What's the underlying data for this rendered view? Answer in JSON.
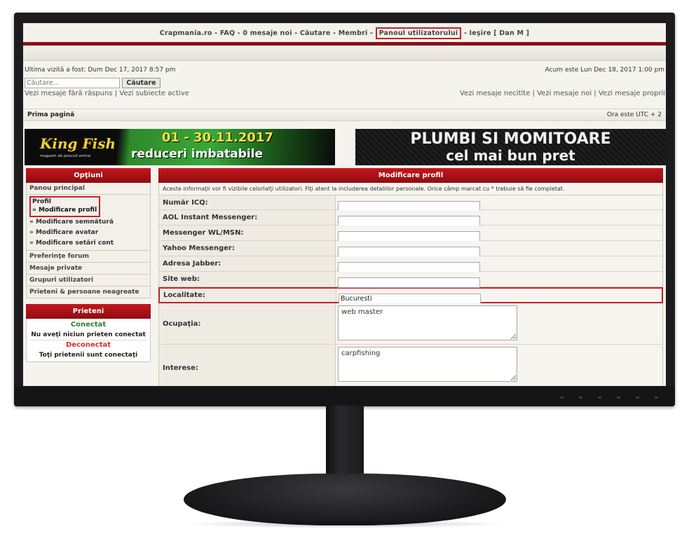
{
  "topnav": {
    "items": [
      "Crapmania.ro",
      "FAQ",
      "0 mesaje noi",
      "Căutare",
      "Membri",
      "Panoul utilizatorului",
      "Ieşire [ Dan M ]"
    ],
    "separator": " - "
  },
  "header": {
    "last_visit": "Ultima vizită a fost: Dum Dec 17, 2017 8:57 pm",
    "current_time": "Acum este Lun Dec 18, 2017 1:00 pm",
    "search_placeholder": "Căutare...",
    "search_button": "Căutare",
    "links_left": [
      "Vezi mesaje fără răspuns",
      "Vezi subiecte active"
    ],
    "links_right": [
      "Vezi mesaje necitite",
      "Vezi mesaje noi",
      "Vezi mesaje proprii"
    ]
  },
  "breadcrumb": {
    "home": "Prima pagină",
    "timezone": "Ora este UTC + 2"
  },
  "banners": {
    "left": {
      "logo": "King Fish",
      "logo_sub": "magazin de pescuit online",
      "dates": "01 - 30.11.2017",
      "tagline": "reduceri imbatabile"
    },
    "right": {
      "line1": "PLUMBI SI MOMITOARE",
      "line2": "cel mai bun pret"
    }
  },
  "sidebar": {
    "options_title": "Opţiuni",
    "panel_principal": "Panou principal",
    "profil": "Profil",
    "profil_items": [
      "» Modificare profil",
      "» Modificare semnătură",
      "» Modificare avatar",
      "» Modificare setări cont"
    ],
    "other_items": [
      "Preferinţe forum",
      "Mesaje private",
      "Grupuri utilizatori",
      "Prieteni & persoane neagreate"
    ],
    "friends_title": "Prieteni",
    "online_label": "Conectat",
    "online_text": "Nu aveţi niciun prieten conectat",
    "offline_label": "Deconectat",
    "offline_text": "Toţi prietenii sunt conectaţi"
  },
  "form": {
    "title": "Modificare profil",
    "note": "Aceste informaţii vor fi vizibile celorlalţi utilizatori. Fiţi atent la includerea detaliilor personale. Orice câmp marcat cu * trebuie să fie completat.",
    "fields": [
      {
        "label": "Număr ICQ:",
        "value": ""
      },
      {
        "label": "AOL Instant Messenger:",
        "value": ""
      },
      {
        "label": "Messenger WL/MSN:",
        "value": ""
      },
      {
        "label": "Yahoo Messenger:",
        "value": ""
      },
      {
        "label": "Adresa Jabber:",
        "value": ""
      },
      {
        "label": "Site web:",
        "value": ""
      },
      {
        "label": "Localitate:",
        "value": "Bucuresti"
      },
      {
        "label": "Ocupaţia:",
        "value": "web master"
      },
      {
        "label": "Interese:",
        "value": "carpfishing"
      }
    ]
  },
  "colors": {
    "accent_red": "#c4161c",
    "highlight_outline": "#c8202a",
    "online": "#2e7d32",
    "offline": "#d32f2f"
  }
}
